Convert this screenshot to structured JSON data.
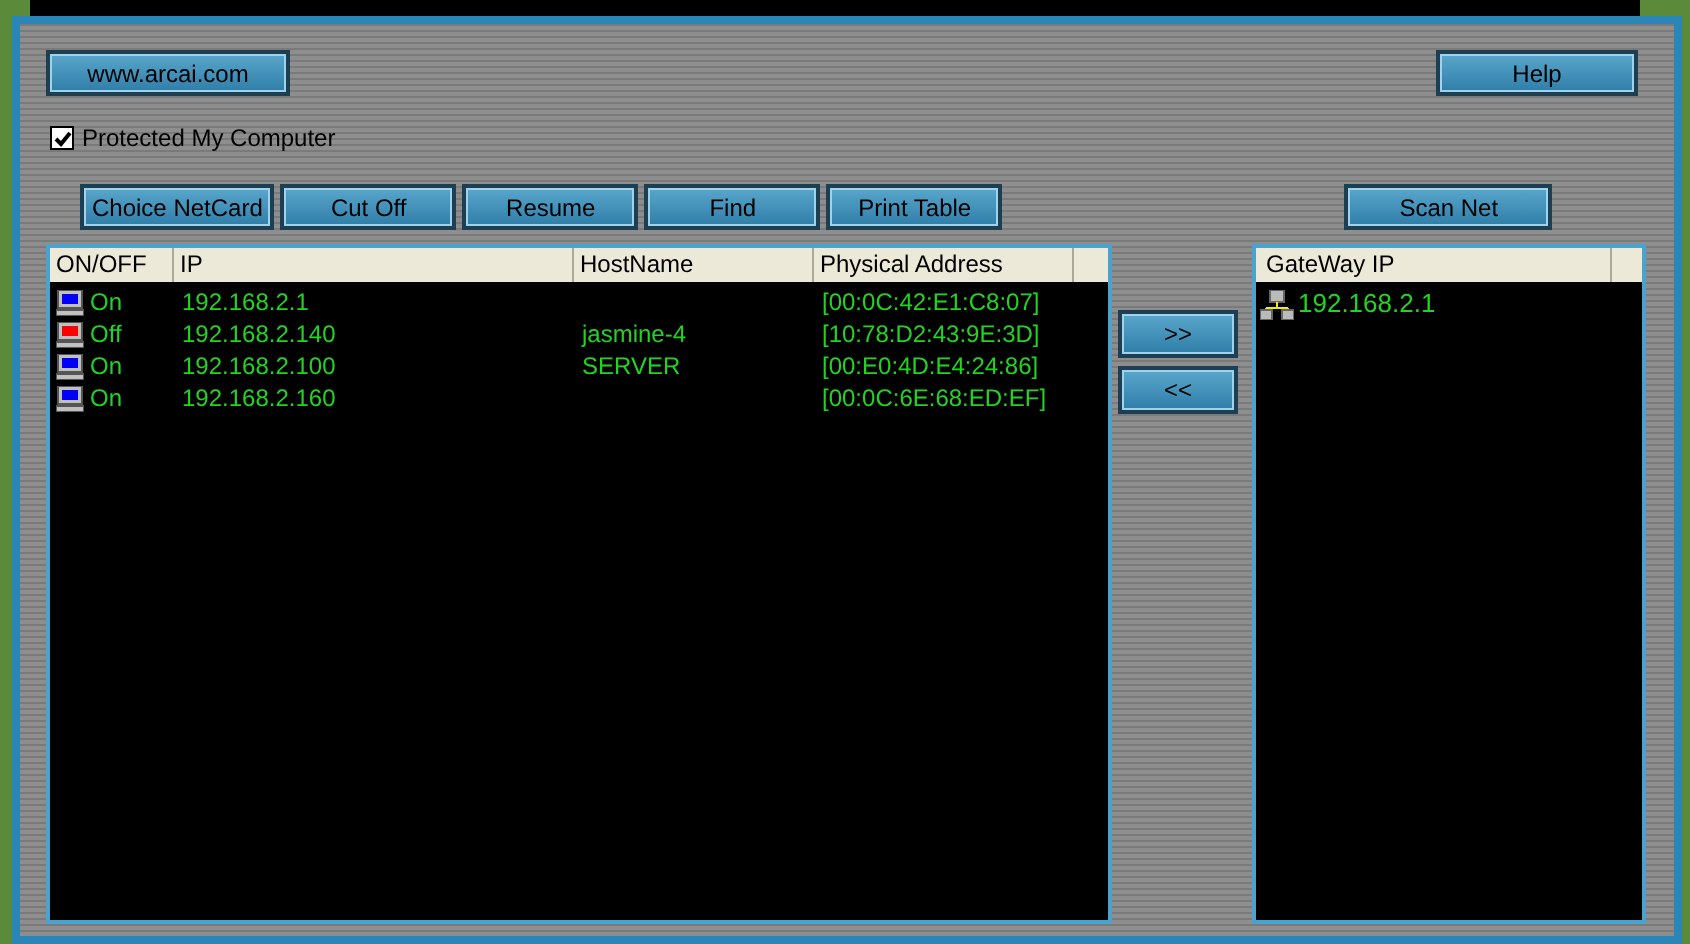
{
  "top_buttons": {
    "website": "www.arcai.com",
    "help": "Help"
  },
  "protect": {
    "label": "Protected My Computer",
    "checked": true
  },
  "toolbar": [
    "Choice NetCard",
    "Cut Off",
    "Resume",
    "Find",
    "Print Table"
  ],
  "scan_button": "Scan Net",
  "table": {
    "columns": [
      "ON/OFF",
      "IP",
      "HostName",
      "Physical Address"
    ],
    "rows": [
      {
        "on": true,
        "status": "On",
        "ip": "192.168.2.1",
        "host": "",
        "mac": "[00:0C:42:E1:C8:07]"
      },
      {
        "on": false,
        "status": "Off",
        "ip": "192.168.2.140",
        "host": "jasmine-4",
        "mac": "[10:78:D2:43:9E:3D]"
      },
      {
        "on": true,
        "status": "On",
        "ip": "192.168.2.100",
        "host": "SERVER",
        "mac": "[00:E0:4D:E4:24:86]"
      },
      {
        "on": true,
        "status": "On",
        "ip": "192.168.2.160",
        "host": "",
        "mac": "[00:0C:6E:68:ED:EF]"
      }
    ]
  },
  "move_buttons": [
    ">>",
    "<<"
  ],
  "gateway": {
    "column": "GateWay IP",
    "rows": [
      "192.168.2.1"
    ]
  }
}
